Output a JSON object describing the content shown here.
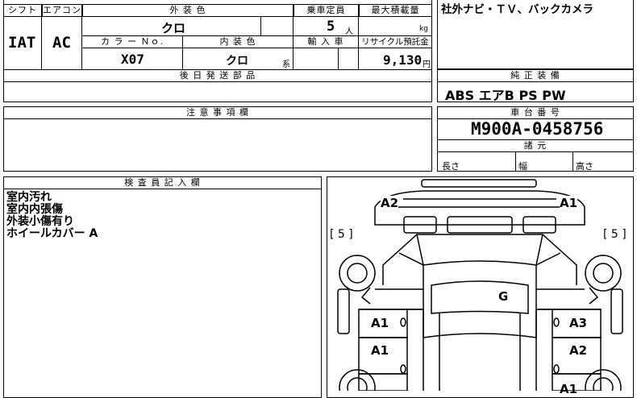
{
  "top_table": {
    "shift_header": "シフト",
    "aircon_header": "エアコン",
    "exterior_color_header": "外 装 色",
    "capacity_header": "乗車定員",
    "max_load_header": "最大積載量",
    "shift_value": "IAT",
    "aircon_value": "AC",
    "exterior_color_value": "クロ",
    "capacity_value": "5",
    "capacity_unit": "人",
    "max_load_unit": "kg",
    "color_no_header": "カ ラ ー Ｎｏ.",
    "interior_color_header": "内 装 色",
    "import_header": "輸 入 車",
    "recycle_header": "リサイクル預託金",
    "color_no_value": "X07",
    "interior_color_value": "クロ",
    "interior_color_suffix": "系",
    "recycle_value": "9,130",
    "recycle_unit": "円",
    "later_parts_header": "後 日 発 送 部 品"
  },
  "options_box": {
    "text": "社外ナビ・ＴＶ、バックカメラ"
  },
  "genuine_equipment": {
    "header": "純 正 装 備",
    "value": "ABS エアB PS PW"
  },
  "notes": {
    "header": "注 意 事 項 欄"
  },
  "chassis": {
    "header": "車 台 番 号",
    "value": "M900A-0458756",
    "specs_header": "諸 元",
    "length_label": "長さ",
    "width_label": "幅",
    "height_label": "高さ"
  },
  "inspector": {
    "header": "検 査 員 記 入 欄",
    "lines": [
      "室内汚れ",
      "室内内張傷",
      "外装小傷有り",
      "ホイールカバー A"
    ]
  },
  "car_diagram": {
    "left_bracket": "[ 5 ]",
    "right_bracket": "[ 5 ]",
    "marks": {
      "front_left": "A2",
      "front_right": "A1",
      "glass": "G",
      "left_front_door": "A1",
      "left_rear_door": "A1",
      "right_front_door": "A3",
      "right_rear_door": "A2",
      "right_rear_partial": "A1"
    }
  }
}
